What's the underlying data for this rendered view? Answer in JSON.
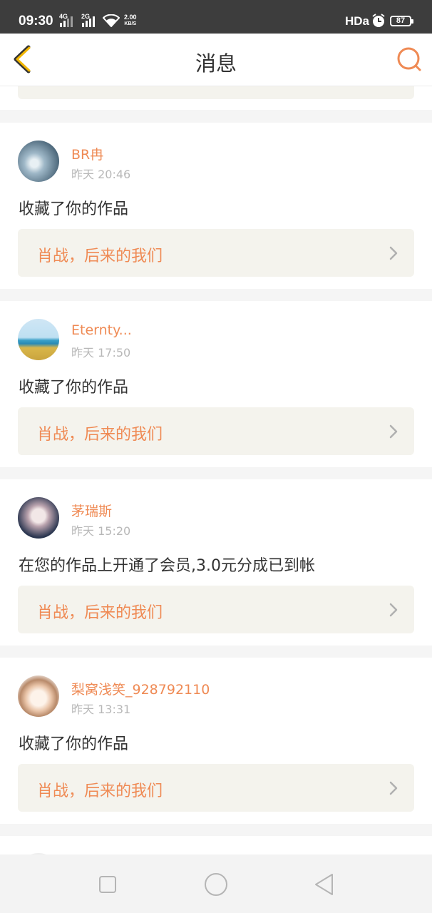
{
  "status_bar": {
    "time": "09:30",
    "signal_1_label": "4G",
    "signal_2_label": "2G",
    "speed_value": "2.00",
    "speed_unit": "KB/S",
    "hd_label": "HDa",
    "battery_level": "87"
  },
  "header": {
    "title": "消息",
    "back_icon": "chevron-left-icon",
    "search_icon": "search-icon"
  },
  "colors": {
    "accent": "#ef8a54",
    "back_arrow": "#f2b600",
    "work_box_bg": "#f4f3ed"
  },
  "notifications": [
    {
      "username": "BR冉",
      "time": "昨天 20:46",
      "message": "收藏了你的作品",
      "work_title": "肖战，后来的我们"
    },
    {
      "username": "Eternty...",
      "time": "昨天 17:50",
      "message": "收藏了你的作品",
      "work_title": "肖战，后来的我们"
    },
    {
      "username": "茅瑞斯",
      "time": "昨天 15:20",
      "message": "在您的作品上开通了会员,3.0元分成已到帐",
      "work_title": "肖战，后来的我们"
    },
    {
      "username": "梨窝浅笑_928792110",
      "time": "昨天 13:31",
      "message": "收藏了你的作品",
      "work_title": "肖战，后来的我们"
    }
  ],
  "nav": {
    "recent_icon": "square-icon",
    "home_icon": "circle-icon",
    "back_icon": "triangle-back-icon"
  }
}
